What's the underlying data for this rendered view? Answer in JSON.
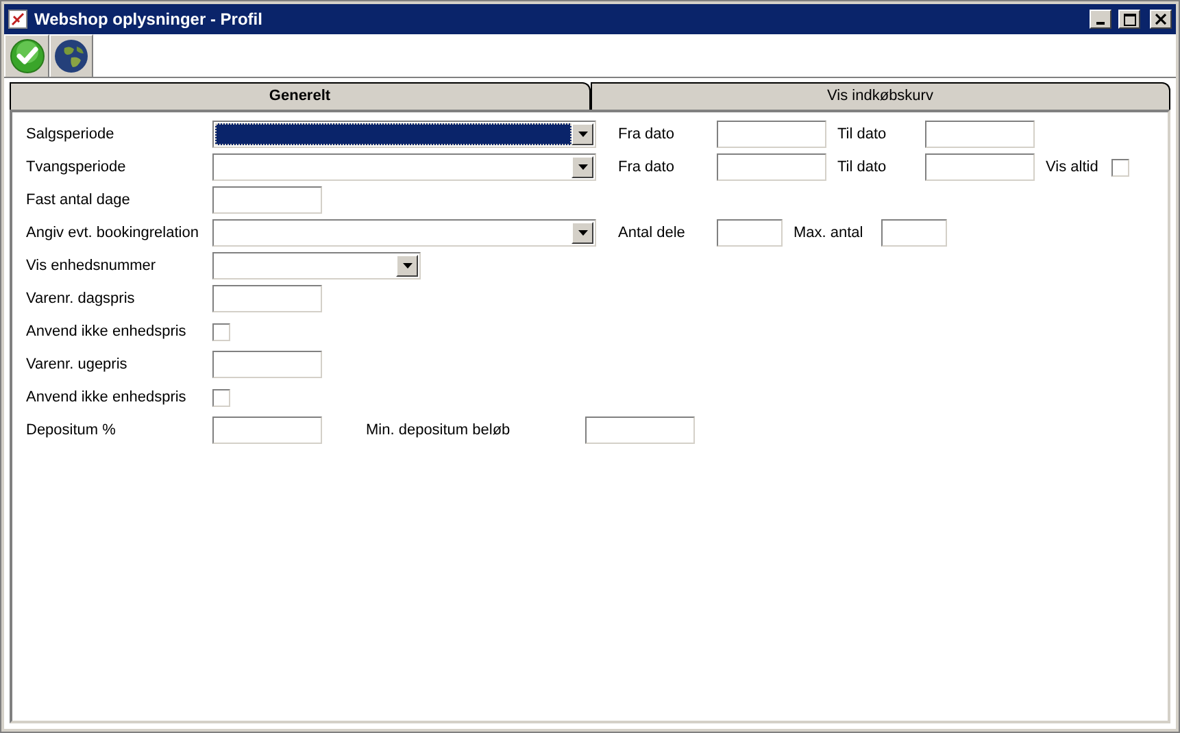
{
  "window": {
    "title": "Webshop oplysninger - Profil"
  },
  "tabs": [
    {
      "label": "Generelt",
      "selected": true
    },
    {
      "label": "Vis indkøbskurv",
      "selected": false
    }
  ],
  "rows": [
    {
      "label": "Salgsperiode",
      "control": {
        "kind": "combo",
        "focused": true
      },
      "extras": [
        {
          "label": "Fra dato",
          "control": {
            "kind": "text"
          }
        },
        {
          "label": "Til dato",
          "control": {
            "kind": "text"
          }
        }
      ]
    },
    {
      "label": "Tvangsperiode",
      "control": {
        "kind": "combo",
        "focused": false
      },
      "extras": [
        {
          "label": "Fra dato",
          "control": {
            "kind": "text"
          }
        },
        {
          "label": "Til dato",
          "control": {
            "kind": "text"
          }
        },
        {
          "label": "Vis altid",
          "control": {
            "kind": "checkbox",
            "checked": false
          }
        }
      ]
    },
    {
      "label": "Fast antal dage",
      "control": {
        "kind": "text"
      }
    },
    {
      "label": "Angiv evt. bookingrelation",
      "control": {
        "kind": "combo",
        "focused": false
      },
      "extras": [
        {
          "label": "Antal dele",
          "control": {
            "kind": "minitext"
          }
        },
        {
          "label": "Max. antal",
          "control": {
            "kind": "minitext"
          }
        }
      ]
    },
    {
      "label": "Vis enhedsnummer",
      "control": {
        "kind": "minicombo",
        "focused": false
      }
    },
    {
      "label": "Varenr. dagspris",
      "control": {
        "kind": "text"
      }
    },
    {
      "label": "Anvend ikke enhedspris",
      "control": {
        "kind": "checkbox",
        "checked": false
      }
    },
    {
      "label": "Varenr. ugepris",
      "control": {
        "kind": "text"
      }
    },
    {
      "label": "Anvend ikke enhedspris",
      "control": {
        "kind": "checkbox",
        "checked": false
      }
    },
    {
      "label": "Depositum %",
      "control": {
        "kind": "text"
      },
      "extras": [
        {
          "label": "Min. depositum beløb",
          "control": {
            "kind": "text"
          }
        }
      ]
    }
  ]
}
